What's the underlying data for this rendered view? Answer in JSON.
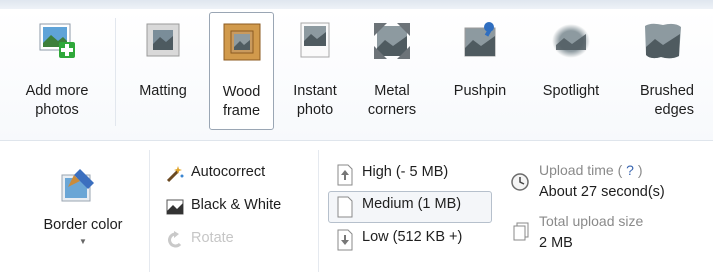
{
  "frames": {
    "add_more_photos": "Add more\nphotos",
    "items": [
      {
        "id": "matting",
        "label": "Matting"
      },
      {
        "id": "wood-frame",
        "label": "Wood\nframe",
        "selected": true
      },
      {
        "id": "instant-photo",
        "label": "Instant\nphoto"
      },
      {
        "id": "metal-corners",
        "label": "Metal\ncorners"
      },
      {
        "id": "pushpin",
        "label": "Pushpin"
      },
      {
        "id": "spotlight",
        "label": "Spotlight"
      },
      {
        "id": "brushed-edges",
        "label": "Brushed\nedges"
      }
    ]
  },
  "border": {
    "label": "Border color"
  },
  "edit": {
    "autocorrect": "Autocorrect",
    "black_white": "Black & White",
    "rotate": "Rotate"
  },
  "size": {
    "high": "High (- 5 MB)",
    "medium": "Medium (1 MB)",
    "low": "Low (512 KB +)",
    "selected": "medium"
  },
  "upload": {
    "time_label": "Upload time (",
    "help": "?",
    "time_label_end": ")",
    "time_value": "About 27 second(s)",
    "total_label": "Total upload size",
    "total_value": "2 MB"
  },
  "icons": {
    "add": "add-photos-icon",
    "wood": "wood-frame-icon",
    "matting": "matting-icon",
    "instant": "instant-photo-icon",
    "metal": "metal-corners-icon",
    "pushpin": "pushpin-icon",
    "spotlight": "spotlight-icon",
    "brushed": "brushed-edges-icon",
    "brush": "paint-brush-icon",
    "wand": "magic-wand-icon",
    "bw": "black-white-icon",
    "rotate": "rotate-icon",
    "page_high": "page-up-icon",
    "page_med": "page-icon",
    "page_low": "page-down-icon",
    "clock": "clock-icon",
    "pages": "pages-icon"
  }
}
